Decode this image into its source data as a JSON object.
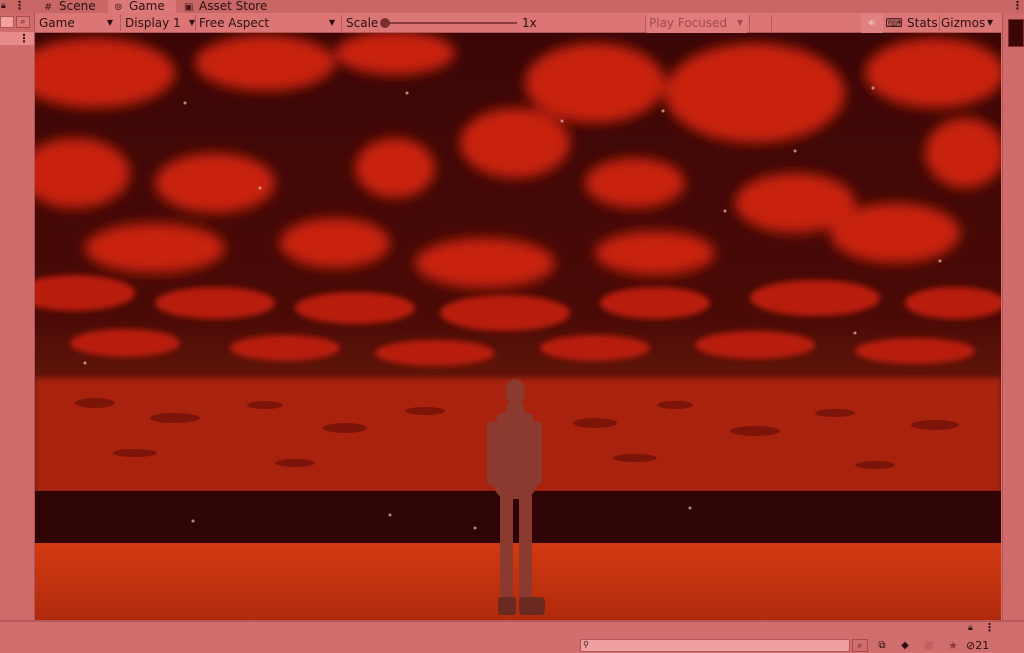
{
  "tabs": [
    {
      "label": "Scene",
      "icon": "grid-icon"
    },
    {
      "label": "Game",
      "icon": "gamepad-icon"
    },
    {
      "label": "Asset Store",
      "icon": "bag-icon"
    }
  ],
  "toolbar": {
    "game_view": "Game",
    "display": "Display 1",
    "aspect": "Free Aspect",
    "scale_label": "Scale",
    "scale_value": "1x",
    "play_mode": "Play Focused",
    "stats": "Stats",
    "gizmos": "Gizmos"
  },
  "project_panel": {
    "search_placeholder": "",
    "hidden_packages_count": "21"
  },
  "icons": {
    "lock": "lock-icon",
    "menu": "kebab-menu-icon",
    "mute": "speaker-icon",
    "keyboard": "keyboard-icon",
    "search": "search-icon",
    "favorite": "star-icon",
    "eye_hidden": "eye-slash-icon"
  },
  "colors": {
    "editor_tint": "#d67272",
    "sky_dark": "#2a0505",
    "clouds": "#c4230f",
    "ground": "#c8300f"
  }
}
